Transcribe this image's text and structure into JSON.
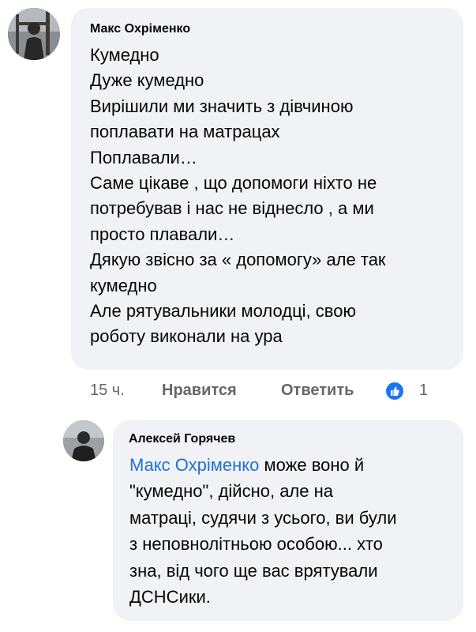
{
  "comment": {
    "author": "Макс Охріменко",
    "lines": [
      "Кумедно",
      "Дуже кумедно",
      "Вирішили ми значить з дівчиною",
      "поплавати на матрацах",
      "Поплавали…",
      "Саме цікаве , що допомоги ніхто не",
      "потребував і нас не віднесло , а ми",
      "просто плавали…",
      "Дякую звісно за « допомогу» але так",
      "кумедно",
      "Але рятувальники молодці, свою",
      "роботу виконали на ура"
    ],
    "time": "15 ч.",
    "like_label": "Нравится",
    "reply_label": "Ответить",
    "reaction_icon": "like-icon",
    "reaction_count": "1",
    "colors": {
      "reaction": "#1877f2"
    }
  },
  "reply": {
    "author": "Алексей Горячев",
    "mention": "Макс Охріменко",
    "first_line_rest": " може воно й",
    "lines": [
      "\"кумедно\", дійсно, але на",
      "матраці, судячи з усього, ви були",
      "з неповнолітньою особою... хто",
      "зна, від чого ще вас врятували",
      "ДСНСики."
    ],
    "colors": {
      "mention": "#216fdb"
    }
  }
}
